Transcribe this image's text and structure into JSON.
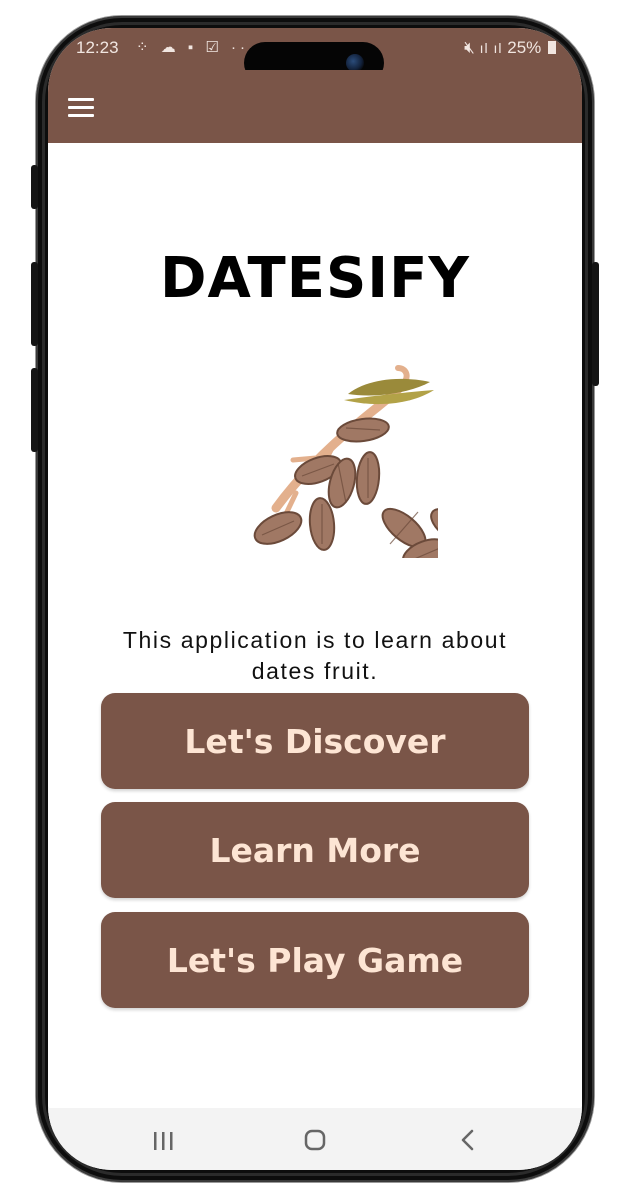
{
  "status_bar": {
    "time": "12:23",
    "notif_icons": "⁘ ☁ ▪ ☑ ···",
    "signal": "ıl ıl",
    "battery": "25%"
  },
  "app_bar": {
    "menu_icon": "hamburger-menu-icon"
  },
  "main": {
    "title": "DATESIFY",
    "illustration": "dates-branch-illustration",
    "description": "This application is to learn about dates fruit."
  },
  "buttons": {
    "discover": "Let's Discover",
    "learn_more": "Learn More",
    "play_game": "Let's Play Game"
  },
  "nav": {
    "recents_icon": "recents-icon",
    "home_icon": "home-icon",
    "back_icon": "back-icon"
  },
  "colors": {
    "primary": "#7a5548",
    "button_text": "#fde5d4",
    "nav_bg": "#f3f3f3"
  }
}
